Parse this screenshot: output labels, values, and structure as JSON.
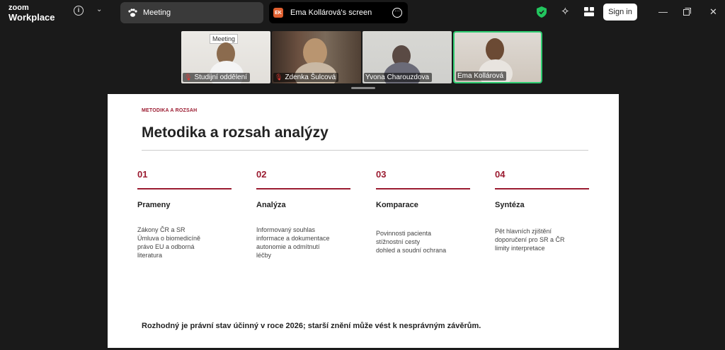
{
  "app": {
    "brand_top": "zoom",
    "brand_bottom": "Workplace"
  },
  "tabs": [
    {
      "label": "Meeting",
      "icon": "paw-icon"
    },
    {
      "label": "Ema Kollárová's screen",
      "initials": "EK"
    }
  ],
  "header": {
    "sign_in_label": "Sign in"
  },
  "participants": [
    {
      "name": "Studijní oddělení",
      "muted": true,
      "board_text": "Meeting"
    },
    {
      "name": "Zdenka Šulcová",
      "muted": true
    },
    {
      "name": "Yvona Charouzdova",
      "muted": false
    },
    {
      "name": "Ema Kollárová",
      "muted": false,
      "active_speaker": true
    }
  ],
  "slide": {
    "eyebrow": "METODIKA A ROZSAH",
    "title": "Metodika a rozsah analýzy",
    "columns": [
      {
        "number": "01",
        "heading": "Prameny",
        "lines": [
          "Zákony ČR a SR",
          "Úmluva o biomedicíně",
          "právo EU a odborná",
          "literatura"
        ]
      },
      {
        "number": "02",
        "heading": "Analýza",
        "lines": [
          "Informovaný souhlas",
          "informace a dokumentace",
          "autonomie a odmítnutí",
          "léčby"
        ]
      },
      {
        "number": "03",
        "heading": "Komparace",
        "lines": [
          "Povinnosti pacienta",
          "stížnostní cesty",
          "dohled a soudní ochrana"
        ]
      },
      {
        "number": "04",
        "heading": "Syntéza",
        "lines": [
          "Pět hlavních zjištění",
          "doporučení pro SR a ČR",
          "limity interpretace"
        ]
      }
    ],
    "footer": "Rozhodný je právní stav účinný v roce 2026; starší znění může vést k nesprávným závěrům."
  },
  "colors": {
    "accent": "#9b1b30",
    "active_speaker_border": "#2ecc71",
    "muted_mic": "#e53935"
  }
}
